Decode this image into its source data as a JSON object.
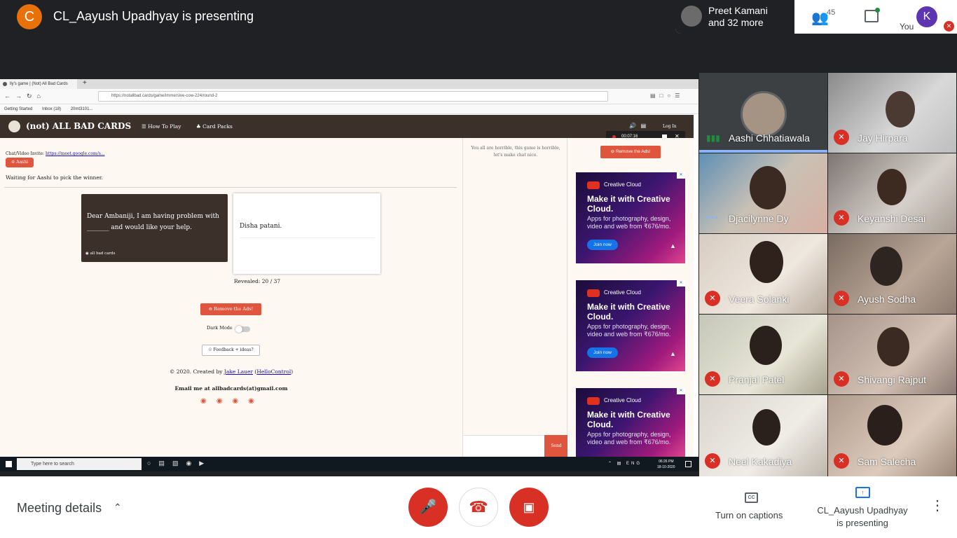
{
  "meet": {
    "presenter_initial": "C",
    "presenting_title": "CL_Aayush Upadhyay is presenting",
    "people_summary_line1": "Preet Kamani",
    "people_summary_line2": "and 32 more",
    "people_count": "45",
    "you_label": "You",
    "you_initial": "K"
  },
  "browser": {
    "tab_title": "lly's game | (Not) All Bad Cards",
    "new_tab": "+",
    "url": "https://notallbad.cards/game/immersive-cow-224/round-2",
    "bookmarks": [
      "Getting Started",
      "Inbox (18)",
      "20mt3101..."
    ]
  },
  "site": {
    "title": "(not) ALL BAD CARDS",
    "nav_how_to_play": "How To Play",
    "nav_card_packs": "Card Packs",
    "login": "Log In",
    "recording_time": "00:07:16",
    "chat_invite_label": "Chat/Video Invite:",
    "chat_invite_link": "https://meet.google.com/s...",
    "player_badge": "Aashi",
    "status": "Waiting for Aashi to pick the winner.",
    "black_card_text": "Dear Ambaniji, I am having problem with _______ and would like your help.",
    "black_card_brand": "all bad cards",
    "white_card_text": "Disha patani.",
    "revealed": "Revealed: 20 / 37",
    "remove_ads": "Remove the Ads!",
    "dark_mode": "Dark Mode",
    "feedback": "Feedback + ideas?",
    "credits_prefix": "© 2020. Created by",
    "credits_author": "Jake Lauer",
    "credits_company": "HelloControl",
    "email": "Email me at allbadcards(at)gmail.com",
    "chat_note": "You all are horrible, this game is horrible, let's make chat nice.",
    "send": "Send"
  },
  "ad": {
    "brand": "Creative Cloud",
    "headline": "Make it with Creative Cloud.",
    "sub": "Apps for photography, design, video and web from ₹676/mo.",
    "cta": "Join now",
    "maker": "Adobe"
  },
  "taskbar": {
    "search_placeholder": "Type here to search",
    "lang": "ENG",
    "time": "06:26 PM",
    "date": "18-10-2020"
  },
  "participants": [
    {
      "name": "Aashi Chhatiawala",
      "state": "speaking"
    },
    {
      "name": "Jay Hirpara",
      "state": "muted"
    },
    {
      "name": "Djacilynne Dy",
      "state": "dots"
    },
    {
      "name": "Keyanshi Desai",
      "state": "muted"
    },
    {
      "name": "Veera Solanki",
      "state": "muted"
    },
    {
      "name": "Ayush Sodha",
      "state": "muted"
    },
    {
      "name": "Pranjal Patel",
      "state": "muted"
    },
    {
      "name": "Shivangi Rajput",
      "state": "muted"
    },
    {
      "name": "Neel Kakadiya",
      "state": "muted"
    },
    {
      "name": "Sam Salecha",
      "state": "muted"
    }
  ],
  "controls": {
    "meeting_details": "Meeting details",
    "captions": "Turn on captions",
    "presenting_line1": "CL_Aayush Upadhyay",
    "presenting_line2": "is presenting"
  },
  "colors": {
    "accent_red": "#d93025",
    "site_brand": "#3b302a",
    "site_orange": "#e0553d"
  }
}
